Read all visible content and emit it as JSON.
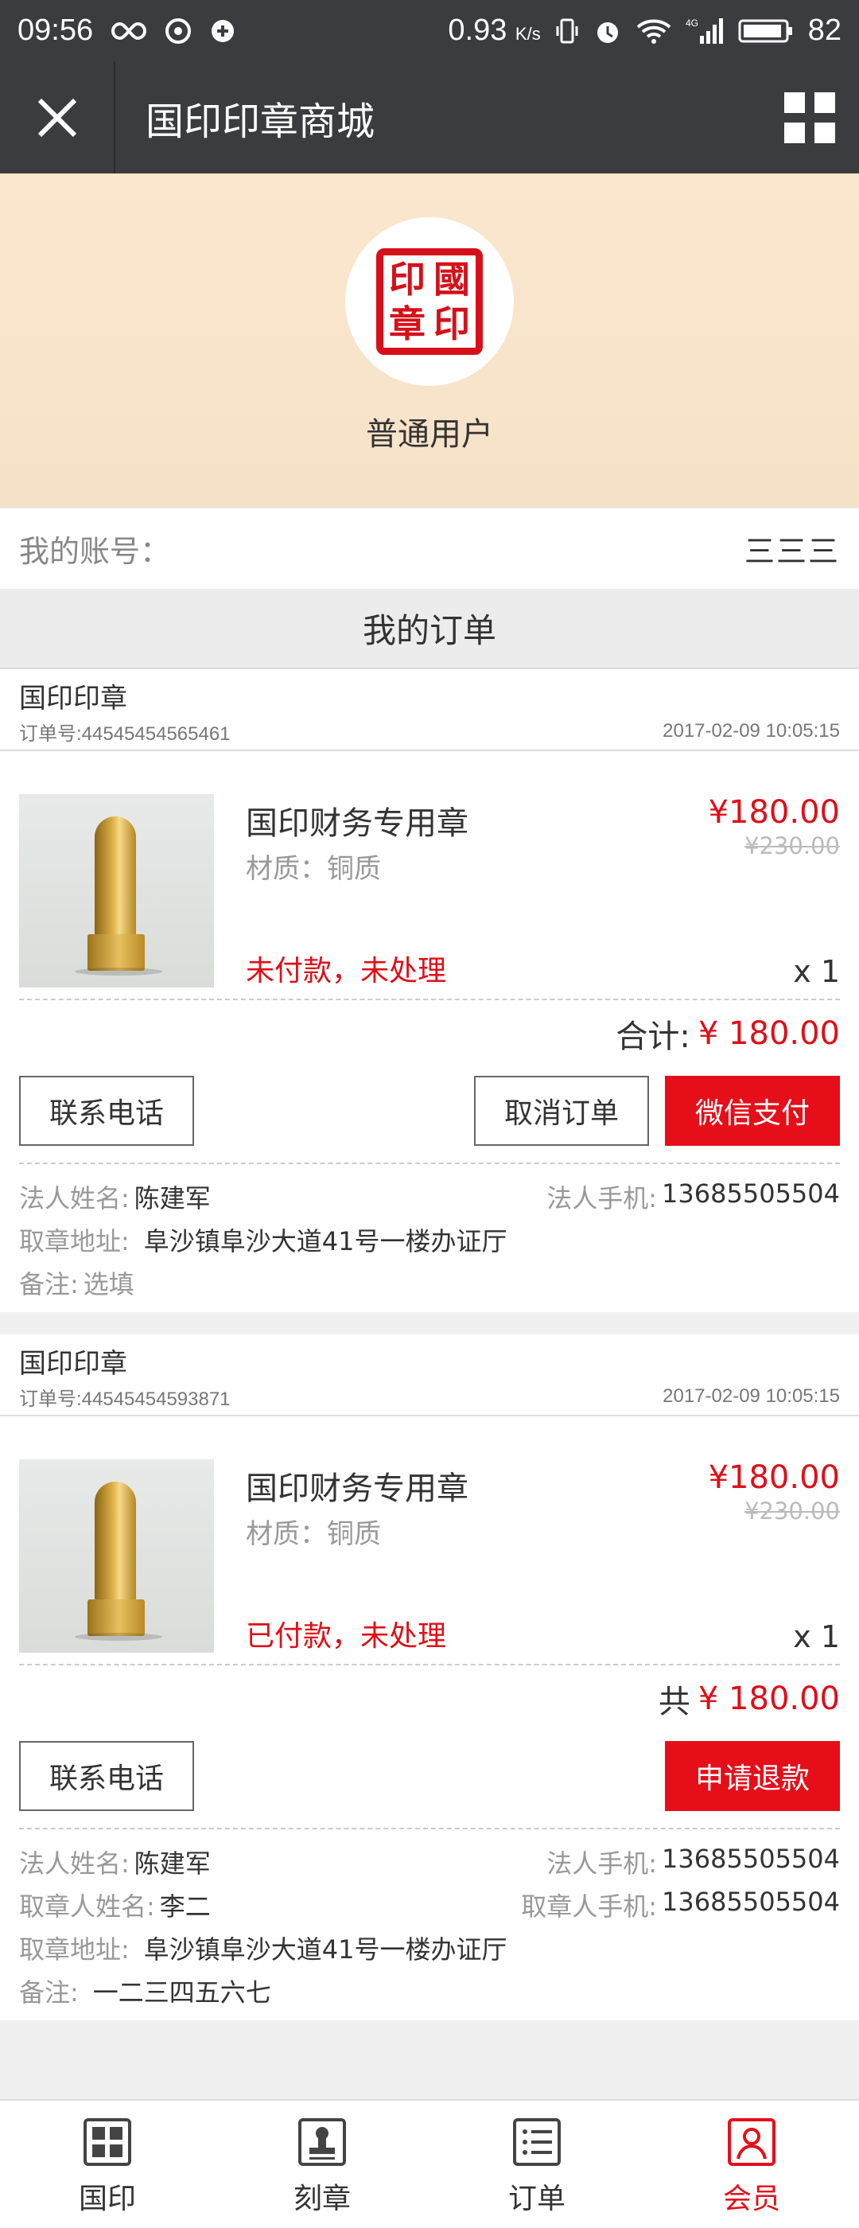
{
  "status_bar": {
    "time": "09:56",
    "net_speed": "0.93",
    "net_unit": "K/s",
    "battery": "82"
  },
  "nav": {
    "title": "国印印章商城"
  },
  "profile": {
    "seal_chars": [
      "印",
      "國",
      "章",
      "印"
    ],
    "user_type": "普通用户"
  },
  "account": {
    "label": "我的账号：",
    "value": "三三三"
  },
  "orders_section": {
    "title": "我的订单"
  },
  "orders": [
    {
      "shop": "国印印章",
      "order_no": "订单号:44545454565461",
      "time": "2017-02-09  10:05:15",
      "product_name": "国印财务专用章",
      "material": "材质：铜质",
      "status": "未付款，未处理",
      "price": "¥180.00",
      "old_price": "¥230.00",
      "qty": "x 1",
      "total_label": "合计:",
      "total_amount": "¥ 180.00",
      "btn_contact": "联系电话",
      "btn_cancel": "取消订单",
      "btn_pay": "微信支付",
      "legal_name_label": "法人姓名:",
      "legal_name": "陈建军",
      "legal_phone_label": "法人手机:",
      "legal_phone": "13685505504",
      "address_label": "取章地址:",
      "address": "阜沙镇阜沙大道41号一楼办证厅",
      "remark_label": "备注:",
      "remark": "选填"
    },
    {
      "shop": "国印印章",
      "order_no": "订单号:44545454593871",
      "time": "2017-02-09  10:05:15",
      "product_name": "国印财务专用章",
      "material": "材质：铜质",
      "status": "已付款，未处理",
      "price": "¥180.00",
      "old_price": "¥230.00",
      "qty": "x 1",
      "total_label": "共",
      "total_amount": "¥ 180.00",
      "btn_contact": "联系电话",
      "btn_refund": "申请退款",
      "legal_name_label": "法人姓名:",
      "legal_name": "陈建军",
      "legal_phone_label": "法人手机:",
      "legal_phone": "13685505504",
      "picker_name_label": "取章人姓名:",
      "picker_name": "李二",
      "picker_phone_label": "取章人手机:",
      "picker_phone": "13685505504",
      "address_label": "取章地址:",
      "address": "阜沙镇阜沙大道41号一楼办证厅",
      "remark_label": "备注:",
      "remark": "一二三四五六七"
    }
  ],
  "tabbar": {
    "items": [
      {
        "label": "国印",
        "icon": "seal-icon"
      },
      {
        "label": "刻章",
        "icon": "stamp-icon"
      },
      {
        "label": "订单",
        "icon": "order-list-icon"
      },
      {
        "label": "会员",
        "icon": "member-icon"
      }
    ],
    "active_index": 3
  },
  "colors": {
    "accent": "#e60e19",
    "navbar": "#3b3c3f"
  }
}
